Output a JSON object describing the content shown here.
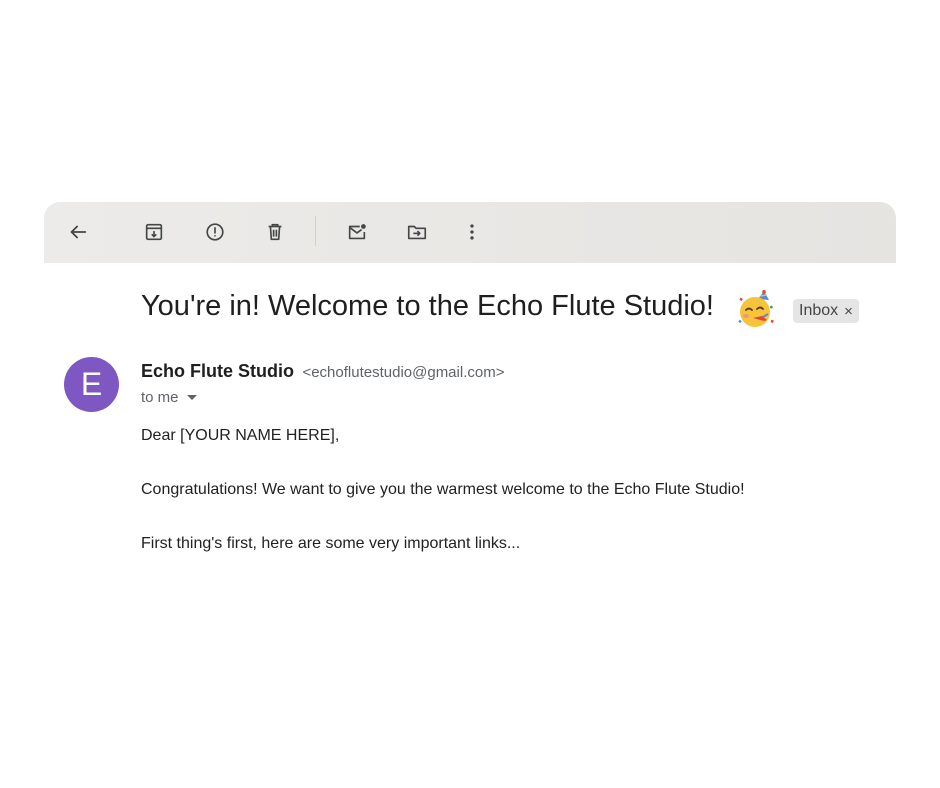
{
  "toolbar": {
    "icons": [
      "back-arrow-icon",
      "archive-icon",
      "report-spam-icon",
      "delete-icon",
      "mark-unread-icon",
      "move-to-icon",
      "more-options-icon"
    ]
  },
  "email": {
    "subject": "You're in! Welcome to the Echo Flute Studio!",
    "subject_emoji": "partying-face-emoji",
    "label": "Inbox",
    "label_remove": "×",
    "sender": {
      "avatar_letter": "E",
      "avatar_color": "#7e57c2",
      "name": "Echo Flute Studio",
      "email": "<echoflutestudio@gmail.com>"
    },
    "recipient": "to me",
    "body": [
      "Dear [YOUR NAME HERE],",
      "Congratulations! We want to give you the warmest welcome to the Echo Flute Studio!",
      "First thing's first, here are some very important links..."
    ]
  }
}
